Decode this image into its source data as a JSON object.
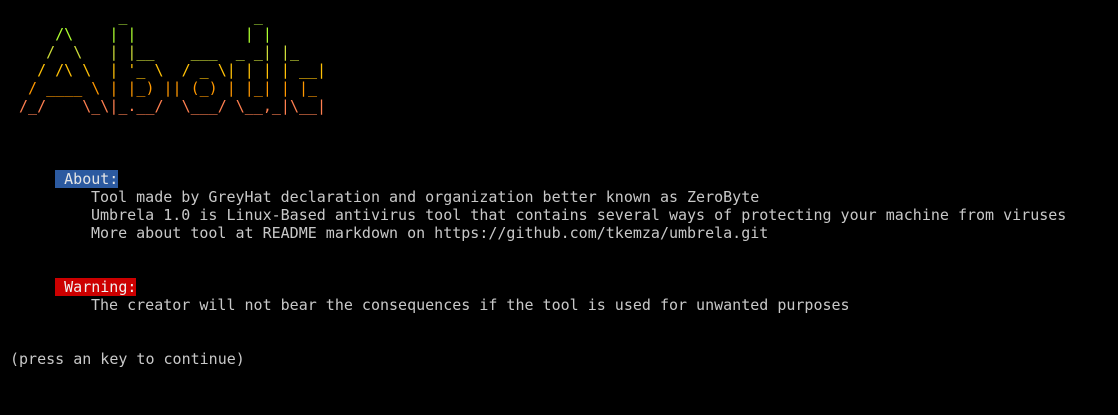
{
  "banner": {
    "rows": [
      "            _              _   ",
      "     /\\    | |            | |  ",
      "    /  \\   | |__    ___  _ _| |_ ",
      "   / /\\ \\  | '_ \\  / _ \\| | | | __|",
      "  / ____ \\ | |_) || (_) | |_| | |_ ",
      " /_/    \\_\\|_.__/  \\___/ \\__,_|\\__|"
    ],
    "colors": [
      "#9ACD32",
      "#ADFF2F",
      "#CDDC39",
      "#FFC107",
      "#FF9800",
      "#FF7F50"
    ]
  },
  "about": {
    "label": " About:",
    "lines": [
      "Tool made by GreyHat declaration and organization better known as ZeroByte",
      "Umbrela 1.0 is Linux-Based antivirus tool that contains several ways of protecting your machine from viruses",
      "More about tool at README markdown on https://github.com/tkemza/umbrela.git"
    ]
  },
  "warning": {
    "label": " Warning:",
    "lines": [
      "The creator will not bear the consequences if the tool is used for unwanted purposes"
    ]
  },
  "prompt": "(press an key to continue)",
  "colors": {
    "background": "#000000",
    "text": "#c8c8c8",
    "about_bg": "#2c5aa0",
    "warning_bg": "#cc0000"
  }
}
